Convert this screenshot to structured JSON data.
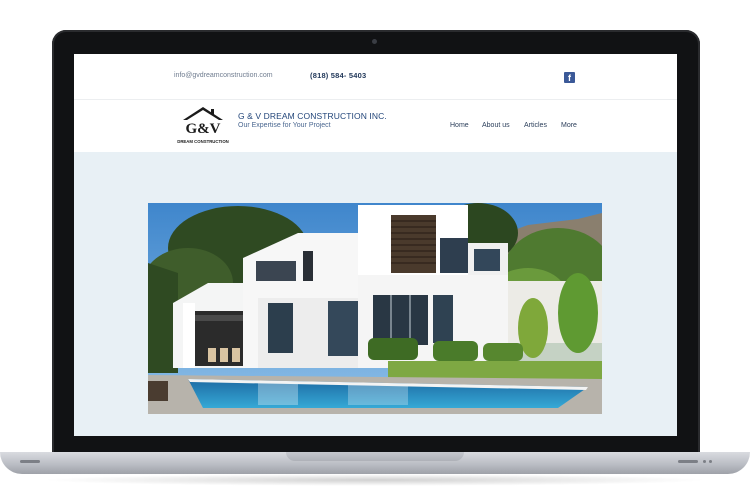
{
  "topbar": {
    "email": "info@gvdreamconstruction.com",
    "phone": "(818) 584- 5403",
    "facebook_icon": "facebook-icon"
  },
  "brand": {
    "logo_letters": "G&V",
    "logo_caption": "DREAM CONSTRUCTION",
    "name": "G & V DREAM CONSTRUCTION INC.",
    "tagline": "Our Expertise for Your Project"
  },
  "nav": {
    "items": [
      {
        "label": "Home"
      },
      {
        "label": "About us"
      },
      {
        "label": "Articles"
      },
      {
        "label": "More"
      }
    ]
  },
  "hero": {
    "image": "modern-white-villa-with-pool-photo"
  },
  "colors": {
    "navy": "#23467a",
    "background": "#e8f0f5",
    "facebook": "#3b5998"
  }
}
